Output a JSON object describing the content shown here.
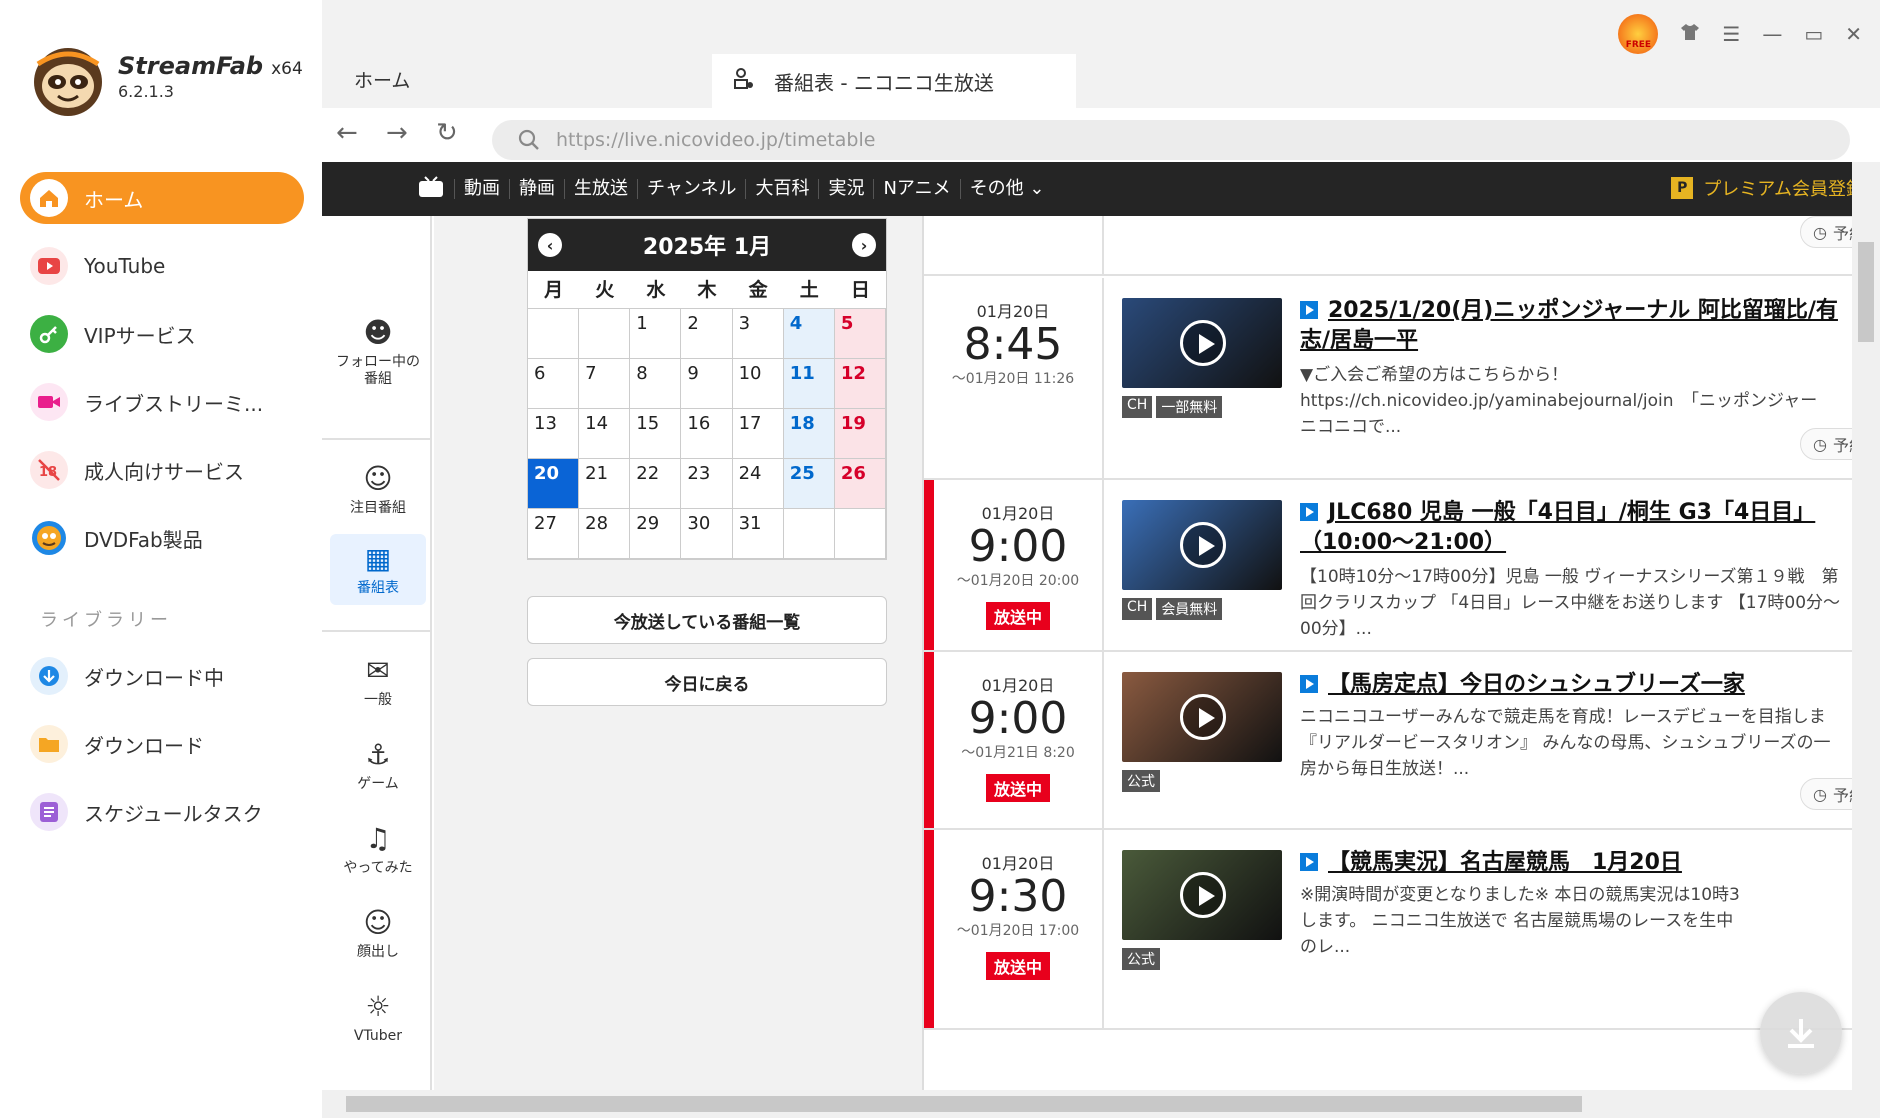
{
  "app": {
    "name": "StreamFab",
    "arch": "x64",
    "version": "6.2.1.3"
  },
  "sidebar": {
    "items": [
      {
        "label": "ホーム",
        "icon": "home-icon",
        "color": "#f89421"
      },
      {
        "label": "YouTube",
        "icon": "youtube-icon",
        "color": "#e84545"
      },
      {
        "label": "VIPサービス",
        "icon": "key-icon",
        "color": "#3cb043"
      },
      {
        "label": "ライブストリーミ...",
        "icon": "video-camera-icon",
        "color": "#e91e8c"
      },
      {
        "label": "成人向けサービス",
        "icon": "adult-18-icon",
        "color": "#e84545"
      },
      {
        "label": "DVDFab製品",
        "icon": "dvdfab-icon",
        "color": "#1e88e5"
      }
    ],
    "library_title": "ライブラリー",
    "library": [
      {
        "label": "ダウンロード中",
        "icon": "download-arrow-icon",
        "color": "#1e88e5"
      },
      {
        "label": "ダウンロード",
        "icon": "folder-icon",
        "color": "#f5a623"
      },
      {
        "label": "スケジュールタスク",
        "icon": "task-list-icon",
        "color": "#9c5fd6"
      }
    ]
  },
  "tabs": {
    "home": "ホーム",
    "active": "番組表 - ニコニコ生放送"
  },
  "browser": {
    "url": "https://live.nicovideo.jp/timetable"
  },
  "nicobar": {
    "links": [
      "動画",
      "静画",
      "生放送",
      "チャンネル",
      "大百科",
      "実況",
      "Nアニメ",
      "その他"
    ],
    "premium": "プレミアム会員登録",
    "premium_badge": "P"
  },
  "innernav": [
    {
      "label": "フォロー中の番組"
    },
    {
      "label": "注目番組"
    },
    {
      "label": "番組表"
    },
    {
      "label": "一般"
    },
    {
      "label": "ゲーム"
    },
    {
      "label": "やってみた"
    },
    {
      "label": "顔出し"
    },
    {
      "label": "VTuber"
    }
  ],
  "calendar": {
    "title": "2025年 1月",
    "weekdays": [
      "月",
      "火",
      "水",
      "木",
      "金",
      "土",
      "日"
    ],
    "today": 20,
    "days": [
      null,
      null,
      1,
      2,
      3,
      4,
      5,
      6,
      7,
      8,
      9,
      10,
      11,
      12,
      13,
      14,
      15,
      16,
      17,
      18,
      19,
      20,
      21,
      22,
      23,
      24,
      25,
      26,
      27,
      28,
      29,
      30,
      31
    ],
    "btn_now": "今放送している番組一覧",
    "btn_today": "今日に戻る"
  },
  "programs": [
    {
      "date": "01月20日",
      "time": "8:45",
      "end": "～01月20日 11:26",
      "live": false,
      "onair": "",
      "thumb_color": "#2a4a7a",
      "tags": [
        "CH",
        "一部無料"
      ],
      "title": "2025/1/20(月)ニッポンジャーナル 阿比留瑠比/有\n志/居島一平",
      "desc": "▼ご入会ご希望の方はこちらから！\nhttps://ch.nicovideo.jp/yaminabejournal/join　「ニッポンジャー\nニコニコで...",
      "reserve": "予約"
    },
    {
      "date": "01月20日",
      "time": "9:00",
      "end": "～01月20日 20:00",
      "live": true,
      "onair": "放送中",
      "thumb_color": "#3a6fb8",
      "tags": [
        "CH",
        "会員無料"
      ],
      "title": "JLC680 児島 一般「4日目」/桐生 G3「4日目」\n（10:00～21:00）",
      "desc": "【10時10分～17時00分】児島 一般 ヴィーナスシリーズ第１９戦　第\n回クラリスカップ 「4日目」レース中継をお送りします 【17時00分～\n00分】...",
      "reserve": ""
    },
    {
      "date": "01月20日",
      "time": "9:00",
      "end": "～01月21日 8:20",
      "live": true,
      "onair": "放送中",
      "thumb_color": "#8a5a40",
      "tags": [
        "公式"
      ],
      "title": "【馬房定点】今日のシュシュブリーズ一家",
      "desc": "ニコニコユーザーみんなで競走馬を育成！レースデビューを目指しま\n『リアルダービースタリオン』 みんなの母馬、シュシュブリーズの一\n房から毎日生放送！...",
      "reserve": "予約"
    },
    {
      "date": "01月20日",
      "time": "9:30",
      "end": "～01月20日 17:00",
      "live": true,
      "onair": "放送中",
      "thumb_color": "#4a5a3a",
      "tags": [
        "公式"
      ],
      "title": "【競馬実況】名古屋競馬　1月20日",
      "desc": "※開演時間が変更となりました※ 本日の競馬実況は10時3\nします。 ニコニコ生放送で 名古屋競馬場のレースを生中\nのレ...",
      "reserve": ""
    }
  ],
  "top_reserve": "予約"
}
